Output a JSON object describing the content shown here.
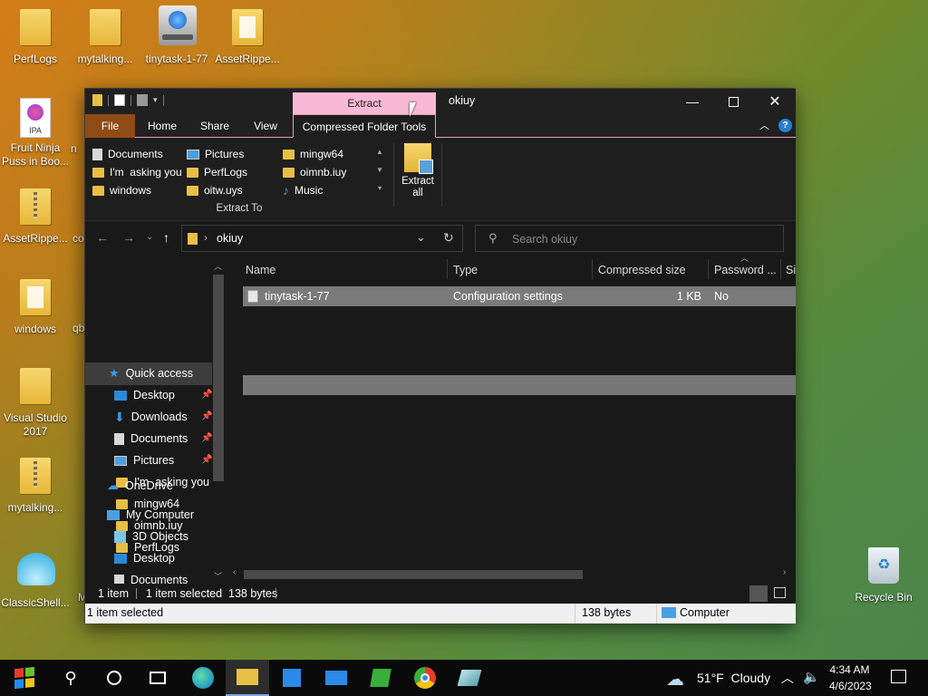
{
  "desktop": {
    "icons": [
      {
        "label": "PerfLogs"
      },
      {
        "label": "mytalking..."
      },
      {
        "label": "tinytask-1-77"
      },
      {
        "label": "AssetRippe..."
      },
      {
        "label": "Fruit Ninja Puss in Boo..."
      },
      {
        "label": "AssetRippe..."
      },
      {
        "label": "windows"
      },
      {
        "label": "Visual Studio 2017"
      },
      {
        "label": "mytalking..."
      },
      {
        "label": "ClassicShell..."
      },
      {
        "label": "Recycle Bin"
      }
    ],
    "partial_labels": {
      "a": "n",
      "b": "co",
      "c": "qb",
      "d": "M"
    },
    "ipa_badge": "IPA"
  },
  "window": {
    "title": "okiuy",
    "context_tab_header": "Extract",
    "tabs": {
      "file": "File",
      "home": "Home",
      "share": "Share",
      "view": "View",
      "compressed": "Compressed Folder Tools"
    },
    "ribbon": {
      "destinations": [
        {
          "label": "Documents",
          "icon": "documents-icon"
        },
        {
          "label": "Pictures",
          "icon": "pictures-icon"
        },
        {
          "label": "mingw64",
          "icon": "folder-icon"
        },
        {
          "label": "I'm  asking you",
          "icon": "folder-icon"
        },
        {
          "label": "PerfLogs",
          "icon": "folder-icon"
        },
        {
          "label": "oimnb.iuy",
          "icon": "folder-icon"
        },
        {
          "label": "windows",
          "icon": "folder-icon"
        },
        {
          "label": "oitw.uys",
          "icon": "folder-icon"
        },
        {
          "label": "Music",
          "icon": "music-icon"
        }
      ],
      "group_label": "Extract To",
      "extract_all": "Extract all"
    },
    "address": {
      "path": "okiuy",
      "search_placeholder": "Search okiuy"
    },
    "nav": {
      "quick_access": "Quick access",
      "items": [
        {
          "label": "Desktop",
          "pinned": true
        },
        {
          "label": "Downloads",
          "pinned": true
        },
        {
          "label": "Documents",
          "pinned": true
        },
        {
          "label": "Pictures",
          "pinned": true
        },
        {
          "label": "I'm  asking you"
        },
        {
          "label": "mingw64"
        },
        {
          "label": "oimnb.iuy"
        },
        {
          "label": "PerfLogs"
        }
      ],
      "onedrive": "OneDrive",
      "my_computer": "My Computer",
      "computer_items": [
        {
          "label": "3D Objects"
        },
        {
          "label": "Desktop"
        },
        {
          "label": "Documents"
        }
      ]
    },
    "columns": {
      "name": "Name",
      "type": "Type",
      "compressed_size": "Compressed size",
      "password": "Password ...",
      "size": "Si"
    },
    "files": [
      {
        "name": "tinytask-1-77",
        "type": "Configuration settings",
        "compressed_size": "1 KB",
        "password": "No"
      }
    ],
    "status": {
      "count": "1 item",
      "selected": "1 item selected  138 bytes",
      "bottom_selected": "1 item selected",
      "bottom_size": "138 bytes",
      "bottom_location": "Computer"
    }
  },
  "taskbar": {
    "weather": "51°F  Cloudy",
    "time": "4:34 AM",
    "date": "4/6/2023"
  }
}
